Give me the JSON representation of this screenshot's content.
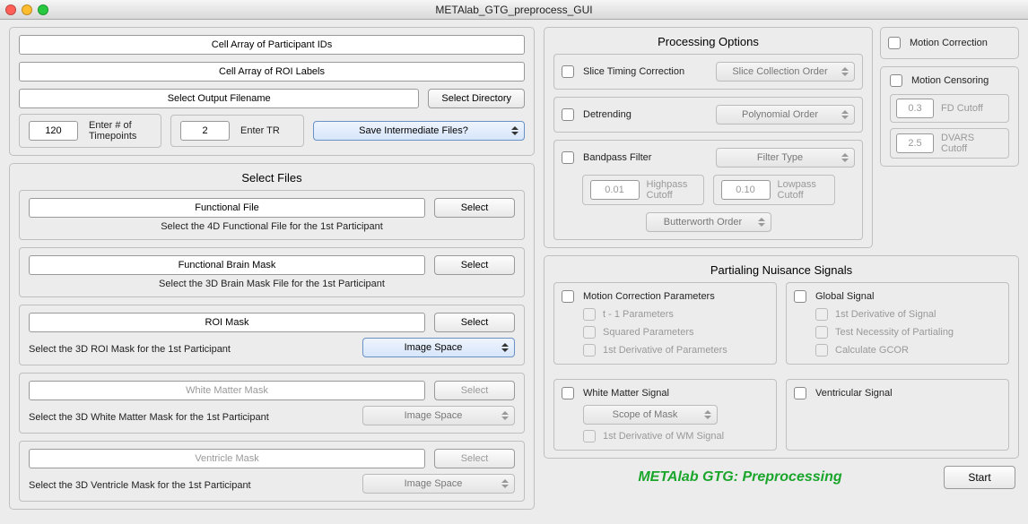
{
  "window": {
    "title": "METAlab_GTG_preprocess_GUI"
  },
  "top": {
    "participant_ids": "Cell Array of Participant IDs",
    "roi_labels": "Cell Array of ROI Labels",
    "output_filename": "Select Output Filename",
    "select_directory": "Select Directory",
    "timepoints_value": "120",
    "timepoints_label": "Enter # of Timepoints",
    "tr_value": "2",
    "tr_label": "Enter TR",
    "save_intermediate": "Save Intermediate Files?"
  },
  "files": {
    "heading": "Select Files",
    "select_btn": "Select",
    "functional": {
      "label": "Functional File",
      "hint": "Select the 4D Functional File for the 1st Participant"
    },
    "brainmask": {
      "label": "Functional Brain Mask",
      "hint": "Select the 3D Brain Mask File for the 1st Participant"
    },
    "roi": {
      "label": "ROI Mask",
      "hint": "Select the 3D ROI Mask for the 1st Participant",
      "space": "Image Space"
    },
    "wm": {
      "label": "White Matter Mask",
      "hint": "Select the 3D White Matter Mask for the 1st Participant",
      "space": "Image Space"
    },
    "vent": {
      "label": "Ventricle Mask",
      "hint": "Select the 3D Ventricle Mask for the 1st Participant",
      "space": "Image Space"
    }
  },
  "proc": {
    "heading": "Processing Options",
    "slice_timing": "Slice Timing Correction",
    "slice_order": "Slice Collection Order",
    "detrending": "Detrending",
    "poly_order": "Polynomial Order",
    "bandpass": "Bandpass Filter",
    "filter_type": "Filter Type",
    "highpass_val": "0.01",
    "highpass_label": "Highpass Cutoff",
    "lowpass_val": "0.10",
    "lowpass_label": "Lowpass Cutoff",
    "butter": "Butterworth Order",
    "motion_corr": "Motion Correction",
    "motion_cens": "Motion Censoring",
    "fd_val": "0.3",
    "fd_label": "FD Cutoff",
    "dvars_val": "2.5",
    "dvars_label": "DVARS Cutoff"
  },
  "partial": {
    "heading": "Partialing Nuisance Signals",
    "motion_params": "Motion Correction Parameters",
    "t1": "t - 1 Parameters",
    "squared": "Squared Parameters",
    "deriv_params": "1st Derivative of Parameters",
    "global": "Global Signal",
    "deriv_signal": "1st Derivative of Signal",
    "test_necessity": "Test Necessity of Partialing",
    "gcor": "Calculate GCOR",
    "wm_signal": "White Matter Signal",
    "scope": "Scope of Mask",
    "deriv_wm": "1st Derivative of WM Signal",
    "vent_signal": "Ventricular Signal"
  },
  "footer": {
    "brand": "METAlab GTG: Preprocessing",
    "start": "Start"
  }
}
